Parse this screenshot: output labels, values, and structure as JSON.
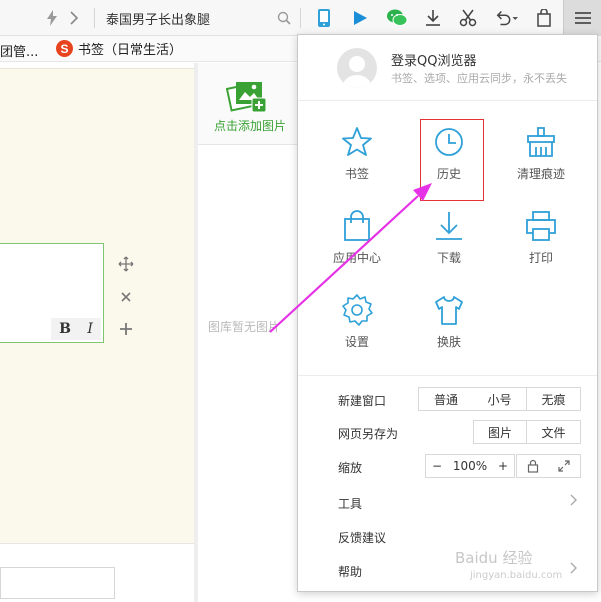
{
  "toolbar": {
    "url_text": "泰国男子长出象腿",
    "icons": [
      "lightning-icon",
      "chevron-right-icon",
      "search-icon",
      "phone-icon",
      "play-icon",
      "wechat-icon",
      "download-icon",
      "scissors-icon",
      "undo-icon",
      "bag-icon",
      "menu-icon"
    ]
  },
  "bookmarks": {
    "item1": "团管...",
    "item2": "书签（日常生活）",
    "item2_icon": "S"
  },
  "content": {
    "add_image_label": "点击添加图片",
    "no_image_text": "图库暂无图片",
    "bold_label": "B",
    "italic_label": "I"
  },
  "menu": {
    "login_title": "登录QQ浏览器",
    "login_subtitle": "书签、选项、应用云同步，永不丢失",
    "grid": [
      {
        "label": "书签",
        "icon": "star-icon"
      },
      {
        "label": "历史",
        "icon": "clock-icon"
      },
      {
        "label": "清理痕迹",
        "icon": "broom-icon"
      },
      {
        "label": "应用中心",
        "icon": "shopping-bag-icon"
      },
      {
        "label": "下载",
        "icon": "download-icon"
      },
      {
        "label": "打印",
        "icon": "printer-icon"
      },
      {
        "label": "设置",
        "icon": "gear-icon"
      },
      {
        "label": "换肤",
        "icon": "tshirt-icon"
      }
    ],
    "new_window": {
      "label": "新建窗口",
      "buttons": [
        "普通",
        "小号",
        "无痕"
      ]
    },
    "save_as": {
      "label": "网页另存为",
      "buttons": [
        "图片",
        "文件"
      ]
    },
    "zoom": {
      "label": "缩放",
      "minus": "−",
      "value": "100%",
      "plus": "+"
    },
    "tools": "工具",
    "feedback": "反馈建议",
    "help": "帮助"
  },
  "watermark": {
    "main": "Baidu 经验",
    "sub": "jingyan.baidu.com"
  },
  "colors": {
    "accent_blue": "#2fa0d8",
    "highlight_red": "#e53333",
    "arrow_magenta": "#e632e6",
    "green": "#3aa235"
  }
}
